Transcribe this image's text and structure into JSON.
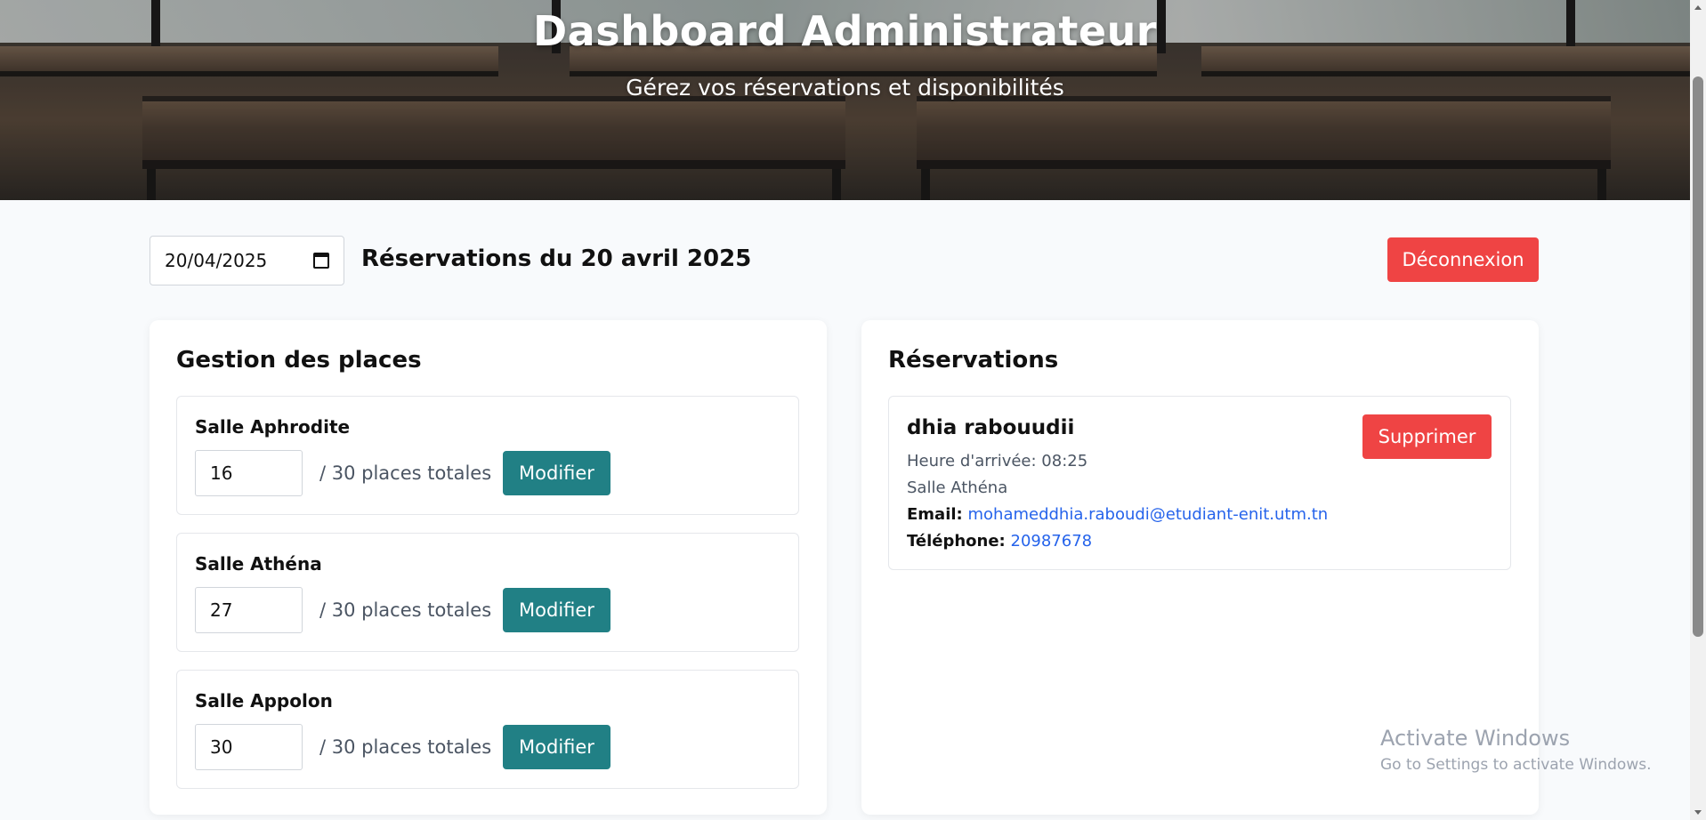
{
  "header": {
    "title": "Dashboard Administrateur",
    "subtitle": "Gérez vos réservations et disponibilités"
  },
  "toolbar": {
    "date_value": "20/04/2025",
    "heading": "Réservations du 20 avril 2025",
    "logout_label": "Déconnexion"
  },
  "places_panel": {
    "title": "Gestion des places",
    "rooms": [
      {
        "name": "Salle Aphrodite",
        "available": "16",
        "total_text": "/ 30 places totales",
        "button": "Modifier"
      },
      {
        "name": "Salle Athéna",
        "available": "27",
        "total_text": "/ 30 places totales",
        "button": "Modifier"
      },
      {
        "name": "Salle Appolon",
        "available": "30",
        "total_text": "/ 30 places totales",
        "button": "Modifier"
      }
    ]
  },
  "reservations_panel": {
    "title": "Réservations",
    "items": [
      {
        "name": "dhia rabouudii",
        "arrival": "Heure d'arrivée: 08:25",
        "room": "Salle Athéna",
        "email_label": "Email:",
        "email": "mohameddhia.raboudi@etudiant-enit.utm.tn",
        "phone_label": "Téléphone:",
        "phone": "20987678",
        "delete_label": "Supprimer"
      }
    ]
  },
  "watermark": {
    "title": "Activate Windows",
    "subtitle": "Go to Settings to activate Windows."
  },
  "colors": {
    "teal_button": "#218085",
    "red_button": "#ef4444",
    "link": "#2563eb",
    "page_bg": "#f8fafc"
  },
  "icons": {
    "date_picker": "calendar-icon"
  }
}
